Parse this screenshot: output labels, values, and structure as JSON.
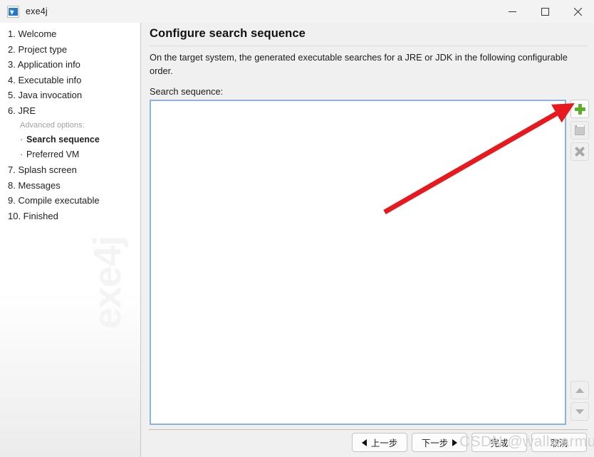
{
  "window": {
    "title": "exe4j",
    "icon": "app-icon",
    "controls": {
      "minimize": "minimize-icon",
      "maximize": "maximize-icon",
      "close": "close-icon"
    }
  },
  "sidebar": {
    "watermark": "exe4j",
    "items": [
      {
        "label": "1. Welcome",
        "type": "step"
      },
      {
        "label": "2. Project type",
        "type": "step"
      },
      {
        "label": "3. Application info",
        "type": "step"
      },
      {
        "label": "4. Executable info",
        "type": "step"
      },
      {
        "label": "5. Java invocation",
        "type": "step"
      },
      {
        "label": "6. JRE",
        "type": "step"
      }
    ],
    "advanced_header": "Advanced options:",
    "advanced_items": [
      {
        "label": "Search sequence",
        "active": true
      },
      {
        "label": "Preferred VM",
        "active": false
      }
    ],
    "items_after": [
      {
        "label": "7. Splash screen",
        "type": "step"
      },
      {
        "label": "8. Messages",
        "type": "step"
      },
      {
        "label": "9. Compile executable",
        "type": "step"
      },
      {
        "label": "10. Finished",
        "type": "step"
      }
    ]
  },
  "main": {
    "title": "Configure search sequence",
    "description": "On the target system, the generated executable searches for a JRE or JDK in the following configurable order.",
    "list_label": "Search sequence:",
    "list_items": []
  },
  "tools": {
    "add": {
      "name": "add-icon",
      "enabled": true
    },
    "duplicate": {
      "name": "copy-icon",
      "enabled": false
    },
    "remove": {
      "name": "delete-icon",
      "enabled": false
    },
    "move_up": {
      "name": "chevron-up-icon",
      "enabled": false
    },
    "move_down": {
      "name": "chevron-down-icon",
      "enabled": false
    }
  },
  "footer": {
    "previous": "上一步",
    "next": "下一步",
    "finish": "完成",
    "cancel": "取消"
  },
  "watermark": {
    "text": "CSDN @wallwarmusic"
  },
  "colors": {
    "accent_border": "#8ab4e0",
    "add_green": "#5cad28",
    "annotation_red": "#e8191e",
    "window_bg": "#f0f0f0"
  }
}
